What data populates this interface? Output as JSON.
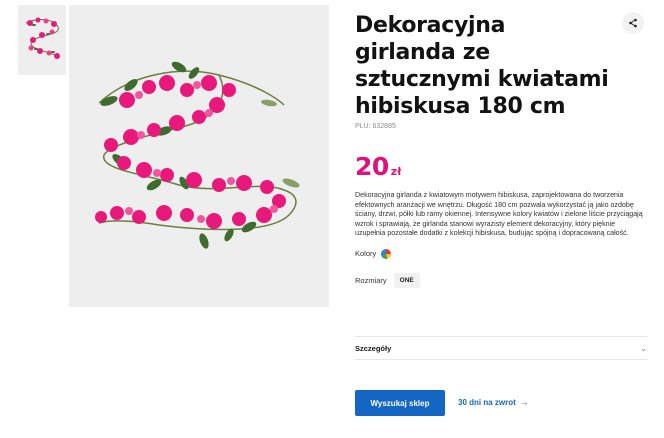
{
  "product": {
    "title": "Dekoracyjna girlanda ze sztucznymi kwiatami hibiskusa 180 cm",
    "plu": "PLU: 632885",
    "price_amount": "20",
    "price_currency": "zł",
    "description": "Dekoracyjna girlanda z kwiatowym motywem hibiskusa, zaprojektowana do tworzenia efektownych aranżacji we wnętrzu. Długość 180 cm pozwala wykorzystać ją jako ozdobę ściany, drzwi, półki lub ramy okiennej. Intensywne kolory kwiatów i zielone liście przyciągają wzrok i sprawiają, że girlanda stanowi wyrazisty element dekoracyjny, który pięknie uzupełnia pozostałe dodatki z kolekcji hibiskusa, budując spójną i dopracowaną całość.",
    "colors_label": "Kolory",
    "sizes_label": "Rozmiary",
    "size_value": "ONE",
    "details_label": "Szczegóły"
  },
  "actions": {
    "find_store": "Wyszukaj sklep",
    "returns": "30 dni na zwrot"
  },
  "icons": {
    "share": "share-icon",
    "chevron": "chevron-down-icon",
    "arrow": "arrow-right-icon"
  },
  "colors": {
    "accent_pink": "#e0107d",
    "primary_blue": "#1466c4",
    "image_bg": "#eeeeee"
  }
}
